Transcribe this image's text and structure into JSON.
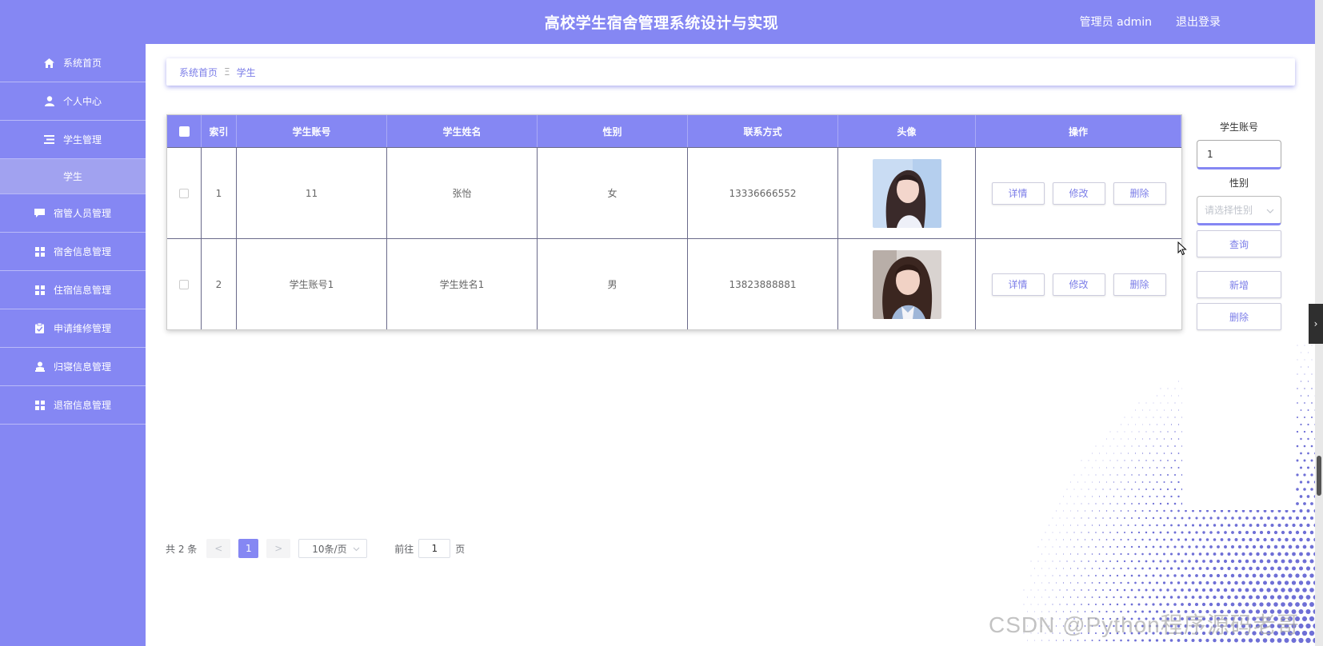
{
  "header": {
    "title": "高校学生宿舍管理系统设计与实现",
    "user": "管理员 admin",
    "logout": "退出登录"
  },
  "sidebar": {
    "items": [
      {
        "label": "系统首页",
        "icon": "home-icon"
      },
      {
        "label": "个人中心",
        "icon": "user-icon"
      },
      {
        "label": "学生管理",
        "icon": "list-icon"
      },
      {
        "label": "学生",
        "icon": "",
        "sub": true
      },
      {
        "label": "宿管人员管理",
        "icon": "chat-icon"
      },
      {
        "label": "宿舍信息管理",
        "icon": "grid-icon"
      },
      {
        "label": "住宿信息管理",
        "icon": "grid-icon"
      },
      {
        "label": "申请维修管理",
        "icon": "clipboard-icon"
      },
      {
        "label": "归寝信息管理",
        "icon": "person-icon"
      },
      {
        "label": "退宿信息管理",
        "icon": "grid-icon"
      }
    ]
  },
  "breadcrumb": {
    "home": "系统首页",
    "separator": "Ξ",
    "current": "学生"
  },
  "table": {
    "headers": [
      "索引",
      "学生账号",
      "学生姓名",
      "性别",
      "联系方式",
      "头像",
      "操作"
    ],
    "rows": [
      {
        "index": "1",
        "account": "11",
        "name": "张怡",
        "sex": "女",
        "phone": "13336666552"
      },
      {
        "index": "2",
        "account": "学生账号1",
        "name": "学生姓名1",
        "sex": "男",
        "phone": "13823888881"
      }
    ],
    "actions": {
      "detail": "详情",
      "edit": "修改",
      "delete": "删除"
    }
  },
  "search": {
    "account_label": "学生账号",
    "account_value": "1",
    "sex_label": "性别",
    "sex_placeholder": "请选择性别",
    "query": "查询",
    "add": "新增",
    "delete": "删除"
  },
  "pagination": {
    "total": "共 2 条",
    "prev": "<",
    "current": "1",
    "next": ">",
    "page_size": "10条/页",
    "goto": "前往",
    "goto_value": "1",
    "page_unit": "页"
  },
  "watermark": "CSDN @Python程序源码老哥",
  "colors": {
    "primary": "#8587f3",
    "accent": "#7c7ee8"
  }
}
